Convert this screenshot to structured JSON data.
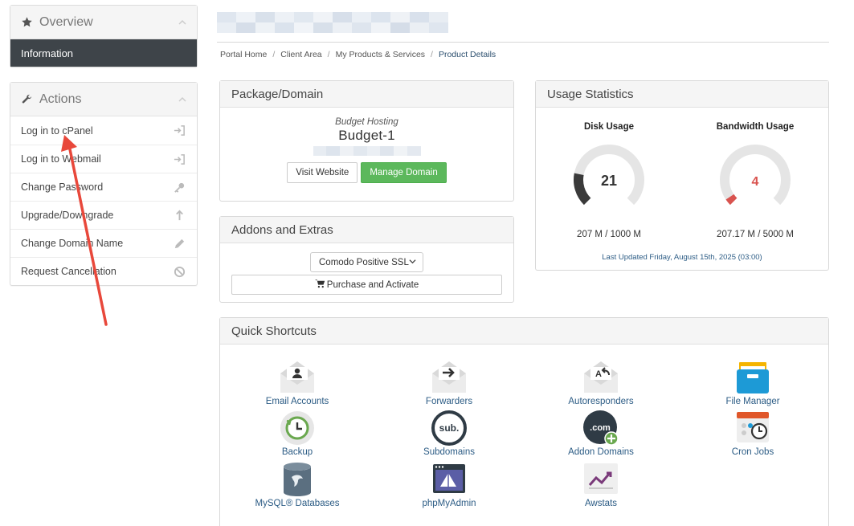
{
  "sidebar": {
    "overview": {
      "title": "Overview",
      "active_item": "Information"
    },
    "actions": {
      "title": "Actions",
      "items": [
        {
          "label": "Log in to cPanel",
          "icon": "sign-in-icon"
        },
        {
          "label": "Log in to Webmail",
          "icon": "sign-in-icon"
        },
        {
          "label": "Change Password",
          "icon": "key-icon"
        },
        {
          "label": "Upgrade/Downgrade",
          "icon": "arrow-up-icon"
        },
        {
          "label": "Change Domain Name",
          "icon": "pencil-icon"
        },
        {
          "label": "Request Cancellation",
          "icon": "ban-icon"
        }
      ]
    }
  },
  "breadcrumb": [
    "Portal Home",
    "Client Area",
    "My Products & Services",
    "Product Details"
  ],
  "package": {
    "title": "Package/Domain",
    "group": "Budget Hosting",
    "name": "Budget-1",
    "visit_label": "Visit Website",
    "manage_label": "Manage Domain"
  },
  "addons": {
    "title": "Addons and Extras",
    "selected": "Comodo Positive SSL",
    "purchase_label": "Purchase and Activate"
  },
  "usage": {
    "title": "Usage Statistics",
    "disk": {
      "title": "Disk Usage",
      "value": "21",
      "fraction": 0.207,
      "detail": "207 M / 1000 M",
      "color": "#3a3a3a"
    },
    "bandwidth": {
      "title": "Bandwidth Usage",
      "value": "4",
      "fraction": 0.041,
      "detail": "207.17 M / 5000 M",
      "color": "#d9534f"
    },
    "updated": "Last Updated Friday, August 15th, 2025 (03:00)"
  },
  "shortcuts": {
    "title": "Quick Shortcuts",
    "items": [
      {
        "label": "Email Accounts",
        "icon": "email-accounts-icon"
      },
      {
        "label": "Forwarders",
        "icon": "forwarders-icon"
      },
      {
        "label": "Autoresponders",
        "icon": "autoresponders-icon"
      },
      {
        "label": "File Manager",
        "icon": "file-manager-icon"
      },
      {
        "label": "Backup",
        "icon": "backup-icon"
      },
      {
        "label": "Subdomains",
        "icon": "subdomains-icon"
      },
      {
        "label": "Addon Domains",
        "icon": "addon-domains-icon"
      },
      {
        "label": "Cron Jobs",
        "icon": "cron-jobs-icon"
      },
      {
        "label": "MySQL® Databases",
        "icon": "mysql-databases-icon"
      },
      {
        "label": "phpMyAdmin",
        "icon": "phpmyadmin-icon"
      },
      {
        "label": "Awstats",
        "icon": "awstats-icon"
      }
    ]
  },
  "colors": {
    "accent": "#5cb85c",
    "sidebar_active": "#3e4449",
    "link": "#2c5c85",
    "annotation_arrow": "#e8483b"
  }
}
